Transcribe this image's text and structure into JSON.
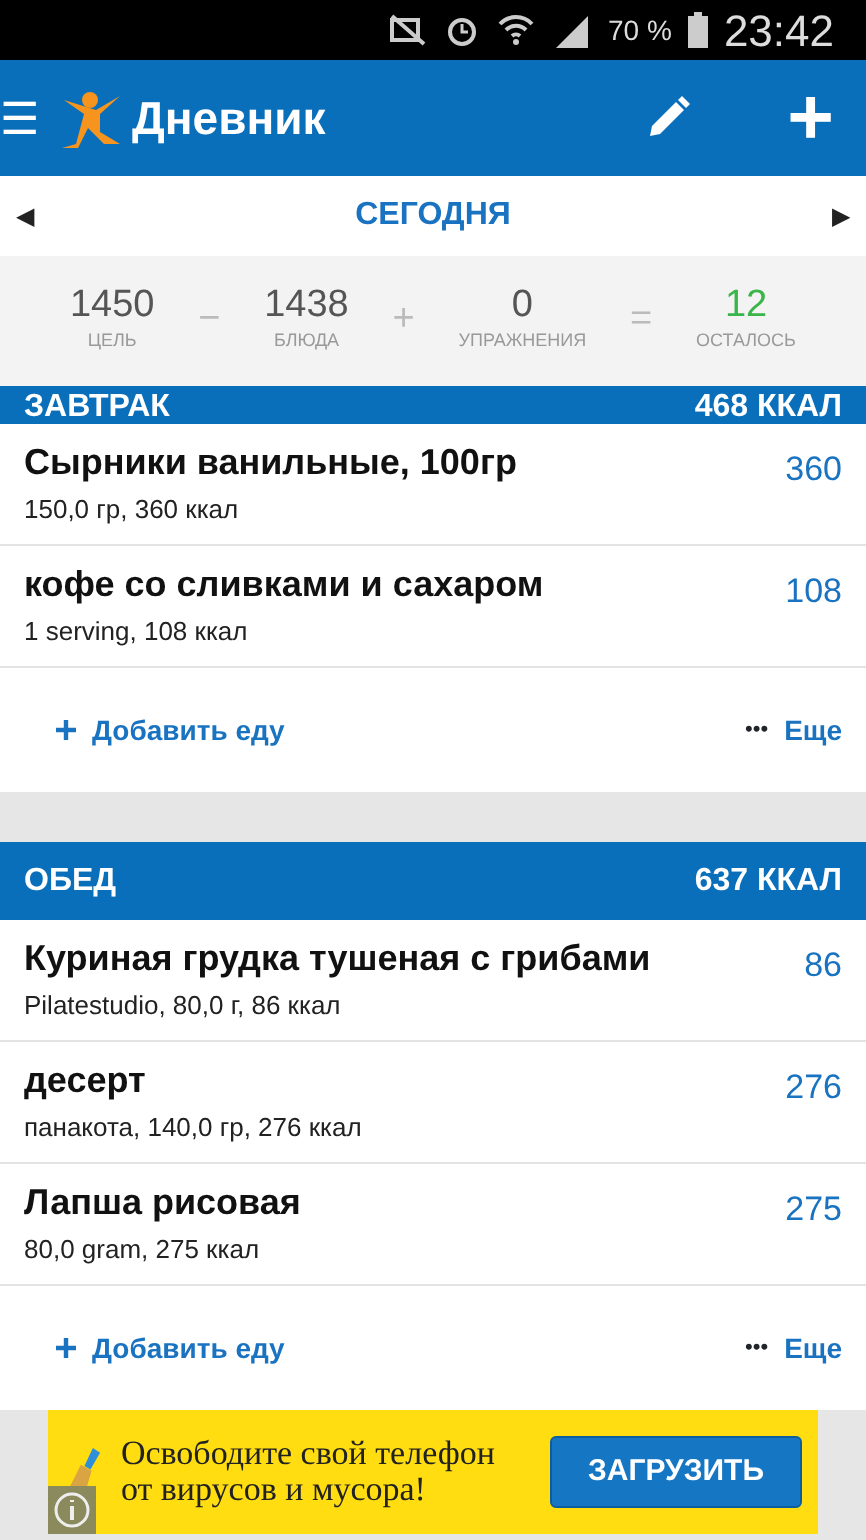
{
  "status_bar": {
    "battery": "70 %",
    "time": "23:42"
  },
  "app_bar": {
    "menu": "☰",
    "title": "Дневник",
    "add": "+"
  },
  "date_nav": {
    "prev": "◀",
    "label": "СЕГОДНЯ",
    "next": "▶"
  },
  "summary": [
    {
      "kind": "value",
      "value": "1450",
      "label": "ЦЕЛЬ"
    },
    {
      "kind": "operator",
      "value": "−"
    },
    {
      "kind": "value",
      "value": "1438",
      "label": "БЛЮДА"
    },
    {
      "kind": "operator",
      "value": "+"
    },
    {
      "kind": "value",
      "value": "0",
      "label": "УПРАЖНЕНИЯ"
    },
    {
      "kind": "operator",
      "value": "="
    },
    {
      "kind": "remaining",
      "value": "12",
      "label": "ОСТАЛОСЬ"
    }
  ],
  "meals": [
    {
      "name": "ЗАВТРАК",
      "total": "468 ККАЛ",
      "cut": true,
      "items": [
        {
          "name": "Сырники ванильные, 100гр",
          "detail": "150,0 гр, 360 ккал",
          "calories": "360"
        },
        {
          "name": "кофе со сливками и сахаром",
          "detail": "1 serving, 108 ккал",
          "calories": "108"
        }
      ],
      "add": "Добавить еду",
      "more_dots": "•••",
      "more": "Еще"
    },
    {
      "name": "ОБЕД",
      "total": "637 ККАЛ",
      "cut": false,
      "items": [
        {
          "name": "Куриная грудка тушеная с грибами",
          "detail": "Pilatestudio, 80,0 г, 86 ккал",
          "calories": "86"
        },
        {
          "name": "десерт",
          "detail": "панакота, 140,0 гр, 276 ккал",
          "calories": "276"
        },
        {
          "name": "Лапша рисовая",
          "detail": "80,0 gram, 275 ккал",
          "calories": "275"
        }
      ],
      "add": "Добавить еду",
      "more_dots": "•••",
      "more": "Еще"
    }
  ],
  "ad": {
    "text": "Освободите свой телефон от вирусов и мусора!",
    "button": "ЗАГРУЗИТЬ"
  }
}
